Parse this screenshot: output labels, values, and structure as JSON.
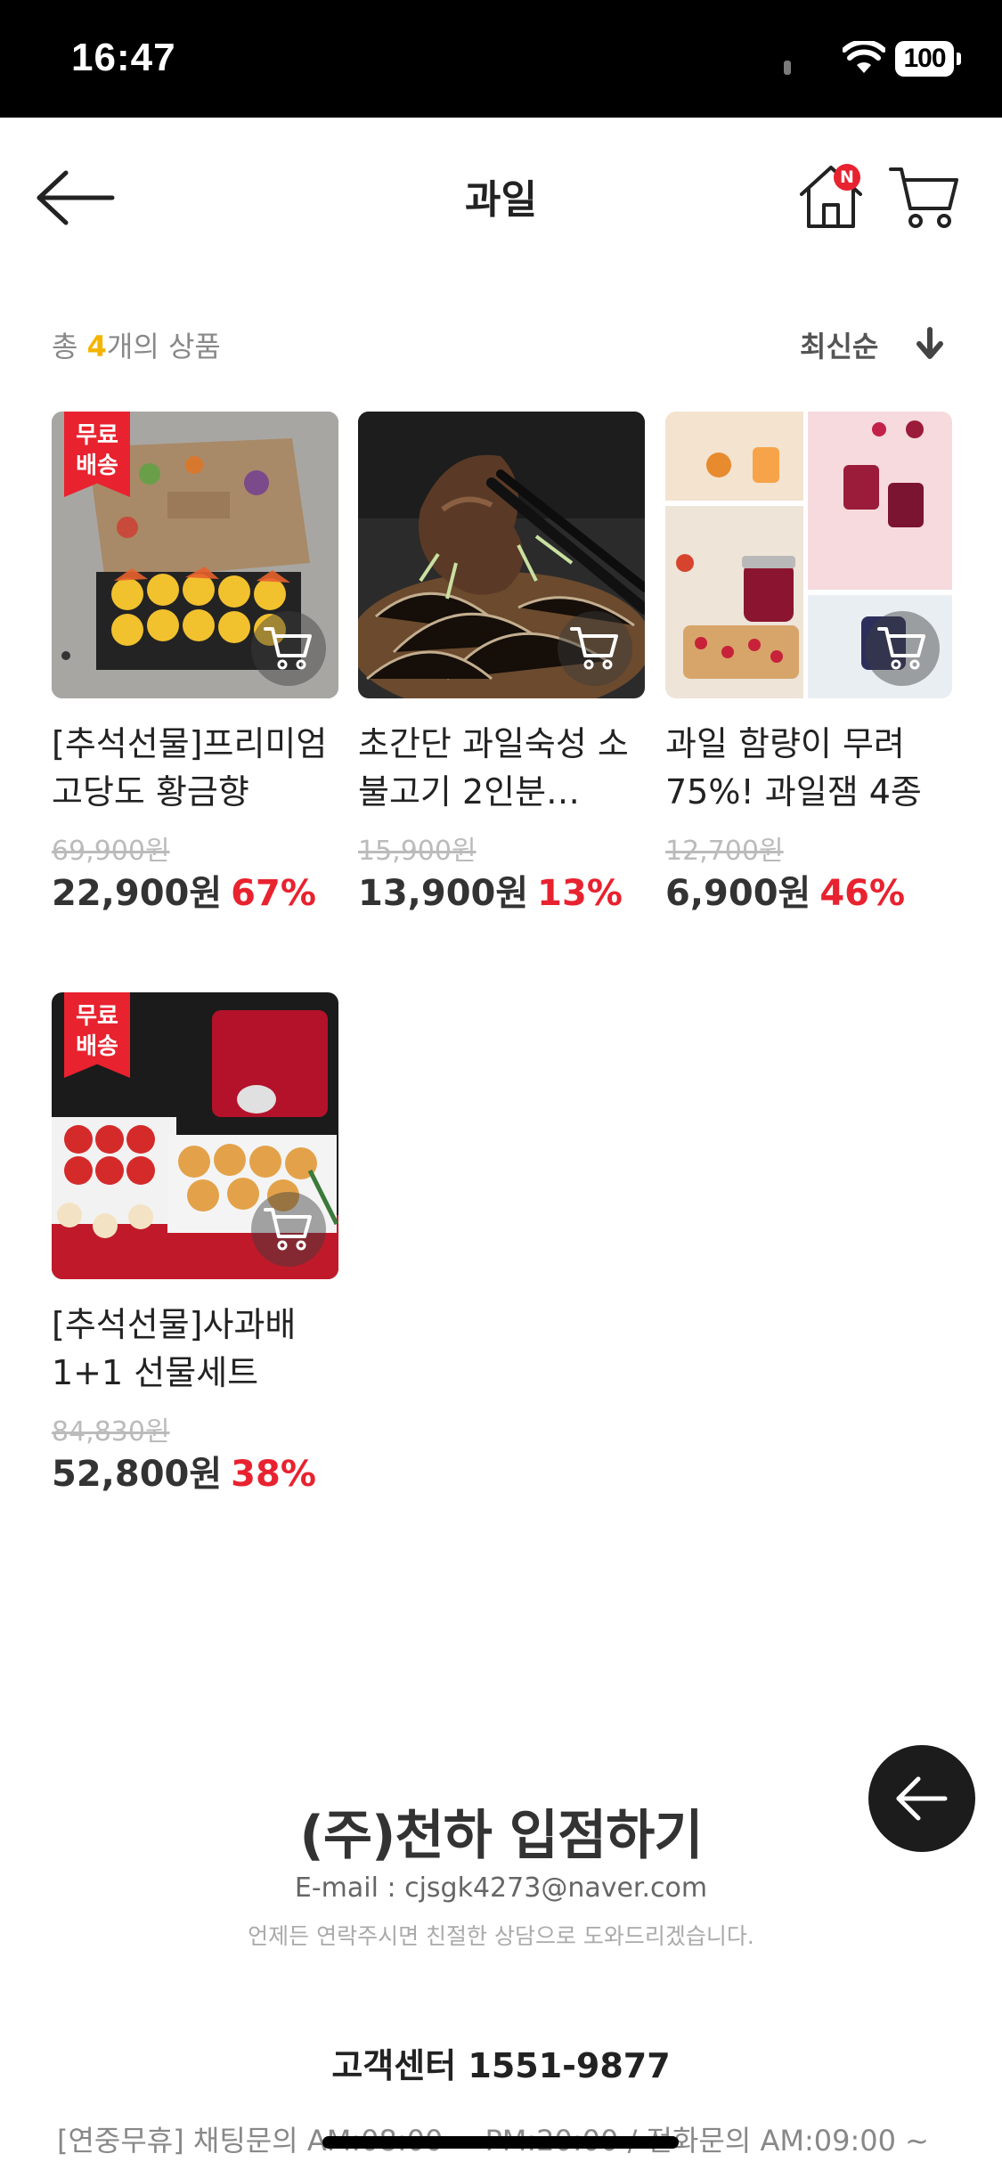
{
  "status_bar": {
    "time": "16:47",
    "battery": "100"
  },
  "header": {
    "title": "과일",
    "home_badge": "N"
  },
  "summary": {
    "prefix": "총 ",
    "count": "4",
    "suffix": "개의 상품",
    "sort_label": "최신순"
  },
  "products": [
    {
      "name": "[추석선물]프리미엄 고당도 황금향",
      "original_price": "69,900원",
      "sale_price": "22,900원",
      "discount": "67%",
      "free_shipping": "무료배송"
    },
    {
      "name": "초간단 과일숙성 소불고기 2인분…",
      "original_price": "15,900원",
      "sale_price": "13,900원",
      "discount": "13%",
      "free_shipping": ""
    },
    {
      "name": "과일 함량이 무려 75%! 과일잼 4종",
      "original_price": "12,700원",
      "sale_price": "6,900원",
      "discount": "46%",
      "free_shipping": ""
    },
    {
      "name": "[추석선물]사과배 1+1 선물세트",
      "original_price": "84,830원",
      "sale_price": "52,800원",
      "discount": "38%",
      "free_shipping": "무료배송"
    }
  ],
  "footer": {
    "title": "(주)천하 입점하기",
    "email": "E-mail : cjsgk4273@naver.com",
    "note": "언제든 연락주시면 친절한 상담으로 도와드리겠습니다.",
    "phone": "고객센터 1551-9877",
    "hours": "[연중무휴] 채팅문의 AM:08:00 ~ PM:20:00 / 전화문의 AM:09:00 ~"
  },
  "colors": {
    "accent_red": "#e8222f",
    "count_yellow": "#f5b400"
  }
}
